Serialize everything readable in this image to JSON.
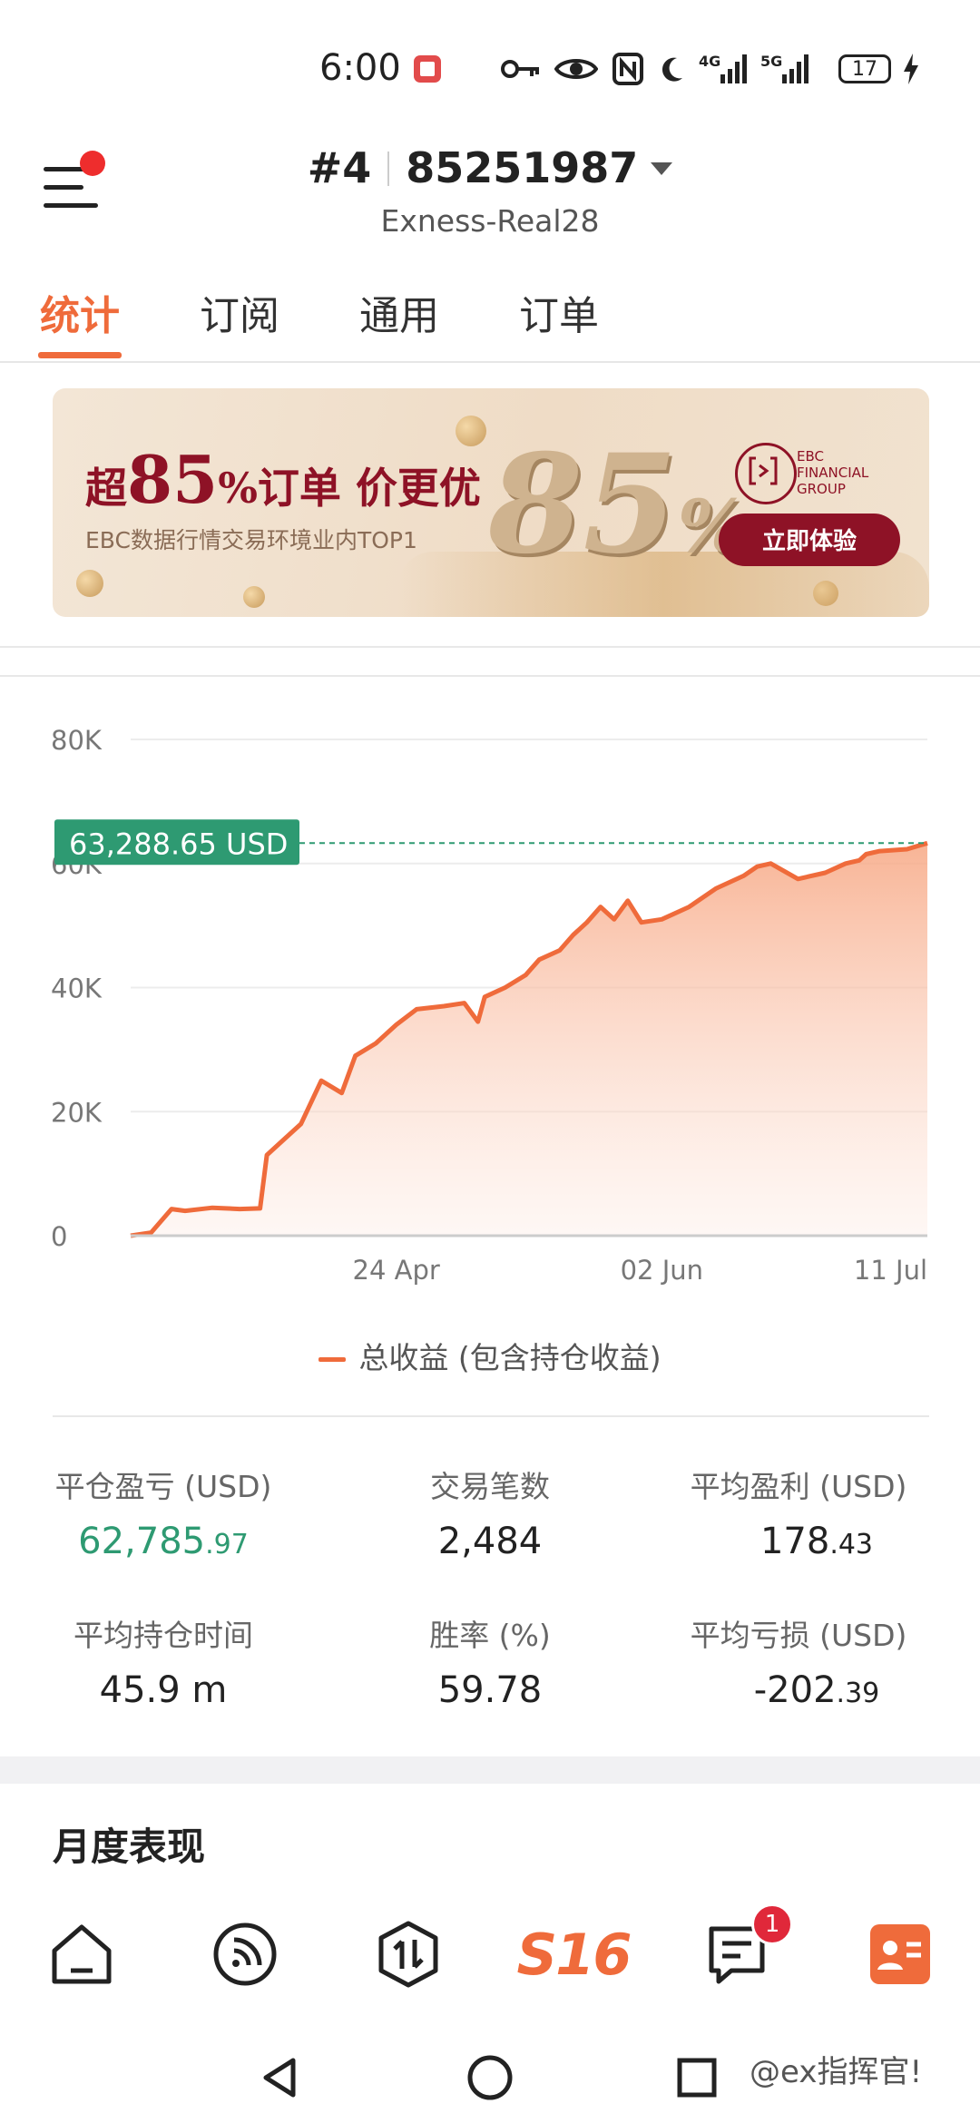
{
  "status_bar": {
    "time": "6:00",
    "signal_4g": "4G",
    "signal_5g": "5G",
    "battery": "17"
  },
  "header": {
    "account_index": "#4",
    "account_number": "85251987",
    "server": "Exness-Real28"
  },
  "tabs": [
    {
      "label": "统计",
      "active": true
    },
    {
      "label": "订阅",
      "active": false
    },
    {
      "label": "通用",
      "active": false
    },
    {
      "label": "订单",
      "active": false
    }
  ],
  "banner": {
    "headline_prefix": "超",
    "headline_number": "85",
    "headline_suffix": "%订单 价更优",
    "subtitle": "EBC数据行情交易环境业内TOP1",
    "big_number": "85",
    "big_percent": "%",
    "logo_text": "EBC\nFINANCIAL\nGROUP",
    "cta": "立即体验"
  },
  "chart_data": {
    "type": "area",
    "current_value_label": "63,288.65 USD",
    "current_value": 63288.65,
    "y_ticks": [
      "80K",
      "60K",
      "40K",
      "20K",
      "0"
    ],
    "y_tick_values": [
      80000,
      60000,
      40000,
      20000,
      0
    ],
    "ylim": [
      0,
      80000
    ],
    "x_ticks": [
      "24 Apr",
      "02 Jun",
      "11 Jul"
    ],
    "x_tick_dates": [
      "2024-04-24",
      "2024-06-02",
      "2024-07-11"
    ],
    "xlim": [
      "2024-03-16",
      "2024-07-11"
    ],
    "grid": true,
    "legend_position": "bottom",
    "series": [
      {
        "name": "总收益 (包含持仓收益)",
        "color": "#ef6b3b",
        "x": [
          "2024-03-16",
          "2024-03-19",
          "2024-03-22",
          "2024-03-24",
          "2024-03-28",
          "2024-04-01",
          "2024-04-04",
          "2024-04-05",
          "2024-04-07",
          "2024-04-10",
          "2024-04-13",
          "2024-04-16",
          "2024-04-18",
          "2024-04-21",
          "2024-04-24",
          "2024-04-27",
          "2024-05-01",
          "2024-05-04",
          "2024-05-06",
          "2024-05-07",
          "2024-05-10",
          "2024-05-13",
          "2024-05-15",
          "2024-05-18",
          "2024-05-20",
          "2024-05-22",
          "2024-05-24",
          "2024-05-26",
          "2024-05-28",
          "2024-05-30",
          "2024-06-02",
          "2024-06-06",
          "2024-06-10",
          "2024-06-14",
          "2024-06-16",
          "2024-06-18",
          "2024-06-22",
          "2024-06-26",
          "2024-06-29",
          "2024-07-01",
          "2024-07-02",
          "2024-07-04",
          "2024-07-08",
          "2024-07-11"
        ],
        "values": [
          0,
          500,
          4300,
          4000,
          4500,
          4300,
          4400,
          13000,
          15000,
          18000,
          25000,
          23000,
          29000,
          31000,
          34000,
          36500,
          37000,
          37500,
          34500,
          38500,
          40000,
          42000,
          44500,
          46000,
          48500,
          50500,
          53000,
          51000,
          54000,
          50500,
          51000,
          53000,
          56000,
          58000,
          59500,
          60000,
          57500,
          58500,
          60000,
          60500,
          61500,
          62000,
          62300,
          63288.65
        ]
      }
    ]
  },
  "stats": [
    {
      "label": "平仓盈亏 (USD)",
      "int": "62,785",
      "dec": ".97",
      "color": "#2e9a72"
    },
    {
      "label": "交易笔数",
      "int": "2,484",
      "dec": "",
      "color": "#222222"
    },
    {
      "label": "平均盈利 (USD)",
      "int": "178",
      "dec": ".43",
      "color": "#222222"
    },
    {
      "label": "平均持仓时间",
      "int": "45.9 m",
      "dec": "",
      "color": "#222222"
    },
    {
      "label": "胜率 (%)",
      "int": "59.78",
      "dec": "",
      "color": "#222222"
    },
    {
      "label": "平均亏损 (USD)",
      "int": "-202",
      "dec": ".39",
      "color": "#222222"
    }
  ],
  "monthly": {
    "title": "月度表现"
  },
  "bottom_nav": {
    "items": [
      {
        "icon": "home-icon"
      },
      {
        "icon": "feed-icon"
      },
      {
        "icon": "trade-icon"
      },
      {
        "icon": "s16-icon",
        "label": "S16"
      },
      {
        "icon": "messages-icon",
        "badge": "1"
      },
      {
        "icon": "profile-card-icon"
      }
    ]
  },
  "watermark": "@ex指挥官!",
  "colors": {
    "accent": "#ef6b3b",
    "profit_green": "#2e9a72",
    "price_tag": "#2e9a72",
    "badge_red": "#e0283a"
  }
}
